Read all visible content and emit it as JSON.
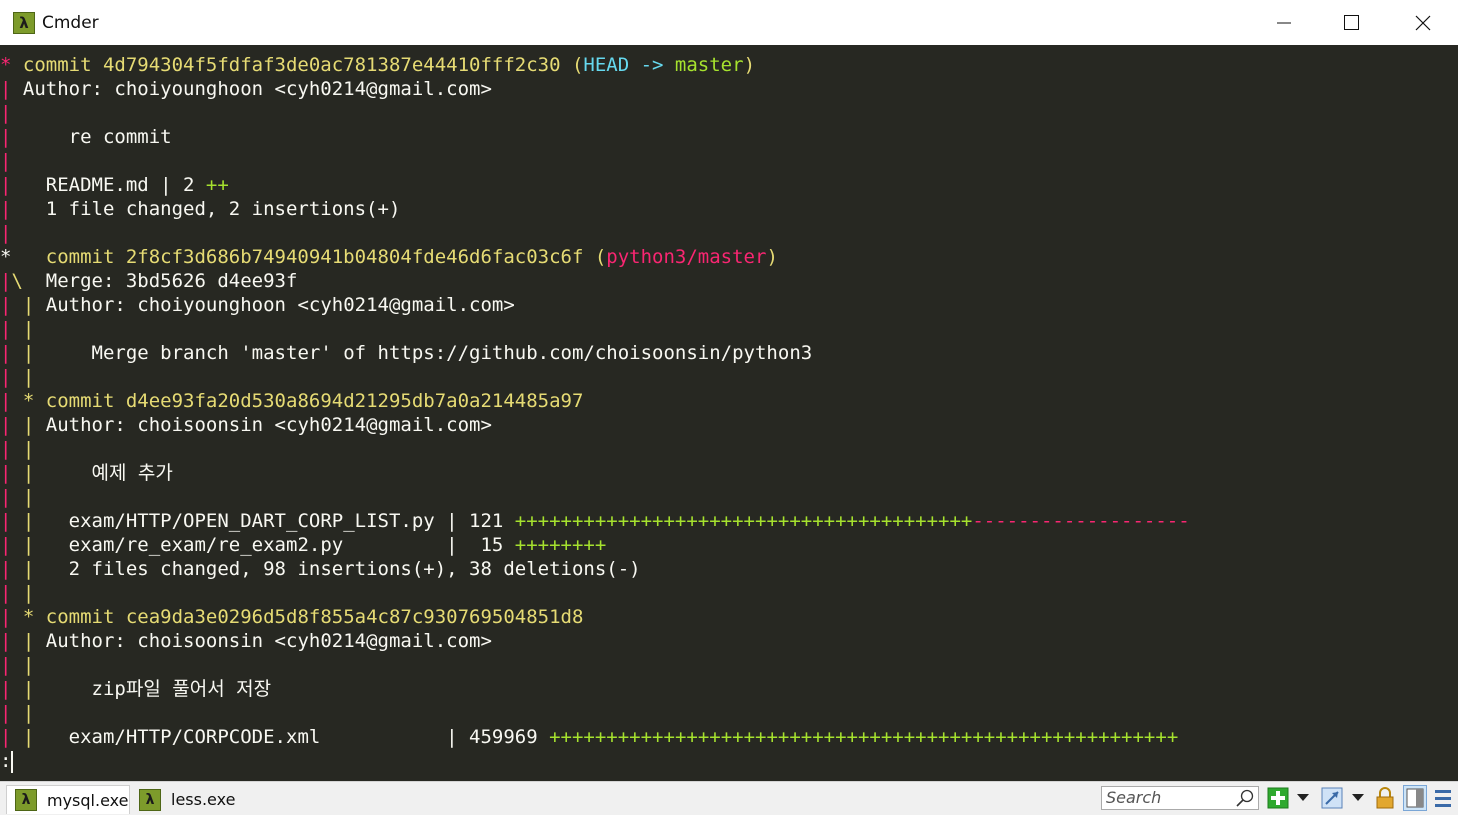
{
  "window": {
    "title": "Cmder",
    "app_icon": "lambda-icon",
    "app_icon_glyph": "λ"
  },
  "terminal": {
    "colors": {
      "background": "#272822",
      "text": "#f8f8f2",
      "yellow": "#e6db74",
      "cyan": "#66d9ef",
      "green": "#a6e22e",
      "red": "#f92672"
    },
    "lines": [
      [
        [
          "g-red",
          "* "
        ],
        [
          "yel",
          "commit 4d794304f5fdfaf3de0ac781387e44410fff2c30 ("
        ],
        [
          "cyan",
          "HEAD -> "
        ],
        [
          "grn",
          "master"
        ],
        [
          "yel",
          ")"
        ]
      ],
      [
        [
          "g-red",
          "| "
        ],
        [
          "",
          "Author: choiyounghoon <cyh0214@gmail.com>"
        ]
      ],
      [
        [
          "g-red",
          "| "
        ]
      ],
      [
        [
          "g-red",
          "| "
        ],
        [
          "",
          "    re commit"
        ]
      ],
      [
        [
          "g-red",
          "| "
        ]
      ],
      [
        [
          "g-red",
          "| "
        ],
        [
          "",
          "  README.md | 2 "
        ],
        [
          "grn",
          "++"
        ]
      ],
      [
        [
          "g-red",
          "| "
        ],
        [
          "",
          "  1 file changed, 2 insertions(+)"
        ]
      ],
      [
        [
          "g-red",
          "| "
        ]
      ],
      [
        [
          "",
          "*   "
        ],
        [
          "yel",
          "commit 2f8cf3d686b74940941b04804fde46d6fac03c6f ("
        ],
        [
          "red",
          "python3/master"
        ],
        [
          "yel",
          ")"
        ]
      ],
      [
        [
          "g-red",
          "|"
        ],
        [
          "g-yel",
          "\\  "
        ],
        [
          "",
          "Merge: 3bd5626 d4ee93f"
        ]
      ],
      [
        [
          "g-red",
          "| "
        ],
        [
          "g-yel",
          "| "
        ],
        [
          "",
          "Author: choiyounghoon <cyh0214@gmail.com>"
        ]
      ],
      [
        [
          "g-red",
          "| "
        ],
        [
          "g-yel",
          "| "
        ]
      ],
      [
        [
          "g-red",
          "| "
        ],
        [
          "g-yel",
          "| "
        ],
        [
          "",
          "    Merge branch 'master' of https://github.com/choisoonsin/python3"
        ]
      ],
      [
        [
          "g-red",
          "| "
        ],
        [
          "g-yel",
          "| "
        ]
      ],
      [
        [
          "g-red",
          "| "
        ],
        [
          "g-yel",
          "* "
        ],
        [
          "yel",
          "commit d4ee93fa20d530a8694d21295db7a0a214485a97"
        ]
      ],
      [
        [
          "g-red",
          "| "
        ],
        [
          "g-yel",
          "| "
        ],
        [
          "",
          "Author: choisoonsin <cyh0214@gmail.com>"
        ]
      ],
      [
        [
          "g-red",
          "| "
        ],
        [
          "g-yel",
          "| "
        ]
      ],
      [
        [
          "g-red",
          "| "
        ],
        [
          "g-yel",
          "| "
        ],
        [
          "",
          "    예제 추가"
        ]
      ],
      [
        [
          "g-red",
          "| "
        ],
        [
          "g-yel",
          "| "
        ]
      ],
      [
        [
          "g-red",
          "| "
        ],
        [
          "g-yel",
          "| "
        ],
        [
          "",
          "  exam/HTTP/OPEN_DART_CORP_LIST.py | 121 "
        ],
        [
          "grn",
          "++++++++++++++++++++++++++++++++++++++++"
        ],
        [
          "red",
          "-------------------"
        ]
      ],
      [
        [
          "g-red",
          "| "
        ],
        [
          "g-yel",
          "| "
        ],
        [
          "",
          "  exam/re_exam/re_exam2.py         |  15 "
        ],
        [
          "grn",
          "++++++++"
        ]
      ],
      [
        [
          "g-red",
          "| "
        ],
        [
          "g-yel",
          "| "
        ],
        [
          "",
          "  2 files changed, 98 insertions(+), 38 deletions(-)"
        ]
      ],
      [
        [
          "g-red",
          "| "
        ],
        [
          "g-yel",
          "| "
        ]
      ],
      [
        [
          "g-red",
          "| "
        ],
        [
          "g-yel",
          "* "
        ],
        [
          "yel",
          "commit cea9da3e0296d5d8f855a4c87c930769504851d8"
        ]
      ],
      [
        [
          "g-red",
          "| "
        ],
        [
          "g-yel",
          "| "
        ],
        [
          "",
          "Author: choisoonsin <cyh0214@gmail.com>"
        ]
      ],
      [
        [
          "g-red",
          "| "
        ],
        [
          "g-yel",
          "| "
        ]
      ],
      [
        [
          "g-red",
          "| "
        ],
        [
          "g-yel",
          "| "
        ],
        [
          "",
          "    zip파일 풀어서 저장"
        ]
      ],
      [
        [
          "g-red",
          "| "
        ],
        [
          "g-yel",
          "| "
        ]
      ],
      [
        [
          "g-red",
          "| "
        ],
        [
          "g-yel",
          "| "
        ],
        [
          "",
          "  exam/HTTP/CORPCODE.xml           | 459969 "
        ],
        [
          "grn",
          "+++++++++++++++++++++++++++++++++++++++++++++++++++++++"
        ]
      ],
      [
        [
          "",
          ":"
        ]
      ]
    ]
  },
  "statusbar": {
    "tabs": [
      {
        "label": "mysql.exe",
        "icon": "lambda-icon",
        "glyph": "λ",
        "active": true
      },
      {
        "label": "less.exe",
        "icon": "lambda-icon",
        "glyph": "λ",
        "active": false
      }
    ],
    "search_placeholder": "Search",
    "tool_icons": [
      "search-icon",
      "new-console-icon",
      "dropdown-icon",
      "view-switch-icon",
      "dropdown-icon",
      "lock-icon",
      "split-view-icon",
      "menu-icon"
    ]
  }
}
